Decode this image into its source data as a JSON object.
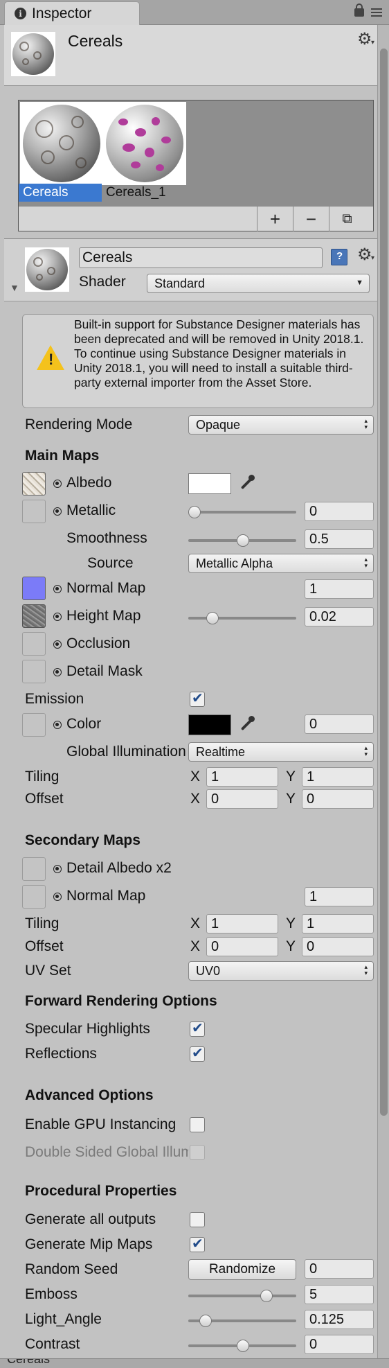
{
  "tab": {
    "title": "Inspector"
  },
  "asset": {
    "name": "Cereals"
  },
  "preview": {
    "items": [
      "Cereals",
      "Cereals_1"
    ],
    "toolbar": {
      "add": "+",
      "remove": "−",
      "duplicate": "⧉"
    }
  },
  "material": {
    "name": "Cereals",
    "shader_label": "Shader",
    "shader_value": "Standard"
  },
  "warning": {
    "text": "Built-in support for Substance Designer materials has been deprecated and will be removed in Unity 2018.1. To continue using Substance Designer materials in Unity 2018.1, you will need to install a suitable third-party external importer from the Asset Store."
  },
  "rendering_mode": {
    "label": "Rendering Mode",
    "value": "Opaque"
  },
  "main_maps": {
    "title": "Main Maps",
    "albedo": {
      "label": "Albedo",
      "color": "#ffffff"
    },
    "metallic": {
      "label": "Metallic",
      "value": "0",
      "level": 0
    },
    "smoothness": {
      "label": "Smoothness",
      "value": "0.5",
      "level": 0.5
    },
    "source": {
      "label": "Source",
      "value": "Metallic Alpha"
    },
    "normal_map": {
      "label": "Normal Map",
      "value": "1"
    },
    "height_map": {
      "label": "Height Map",
      "value": "0.02",
      "level": 0.2
    },
    "occlusion": {
      "label": "Occlusion"
    },
    "detail_mask": {
      "label": "Detail Mask"
    },
    "emission": {
      "label": "Emission",
      "checked": true
    },
    "emission_color": {
      "label": "Color",
      "value": "0",
      "color": "#000000"
    },
    "global_illumination": {
      "label": "Global Illumination",
      "value": "Realtime"
    },
    "tiling": {
      "label": "Tiling",
      "x_label": "X",
      "y_label": "Y",
      "x": "1",
      "y": "1"
    },
    "offset": {
      "label": "Offset",
      "x_label": "X",
      "y_label": "Y",
      "x": "0",
      "y": "0"
    }
  },
  "secondary_maps": {
    "title": "Secondary Maps",
    "detail_albedo": {
      "label": "Detail Albedo x2"
    },
    "normal_map": {
      "label": "Normal Map",
      "value": "1"
    },
    "tiling": {
      "label": "Tiling",
      "x_label": "X",
      "y_label": "Y",
      "x": "1",
      "y": "1"
    },
    "offset": {
      "label": "Offset",
      "x_label": "X",
      "y_label": "Y",
      "x": "0",
      "y": "0"
    },
    "uv_set": {
      "label": "UV Set",
      "value": "UV0"
    }
  },
  "forward_rendering": {
    "title": "Forward Rendering Options",
    "specular": {
      "label": "Specular Highlights",
      "checked": true
    },
    "reflections": {
      "label": "Reflections",
      "checked": true
    }
  },
  "advanced": {
    "title": "Advanced Options",
    "gpu_instancing": {
      "label": "Enable GPU Instancing",
      "checked": false
    },
    "double_sided_gi": {
      "label": "Double Sided Global Illumination",
      "checked": false
    }
  },
  "procedural": {
    "title": "Procedural Properties",
    "generate_all": {
      "label": "Generate all outputs",
      "checked": false
    },
    "mip_maps": {
      "label": "Generate Mip Maps",
      "checked": true
    },
    "random_seed": {
      "label": "Random Seed",
      "button": "Randomize",
      "value": "0"
    },
    "emboss": {
      "label": "Emboss",
      "value": "5",
      "level": 0.72
    },
    "light_angle": {
      "label": "Light_Angle",
      "value": "0.125",
      "level": 0.125
    },
    "contrast": {
      "label": "Contrast",
      "value": "0",
      "level": 0.5
    }
  },
  "footer": {
    "text": "Cereals"
  }
}
